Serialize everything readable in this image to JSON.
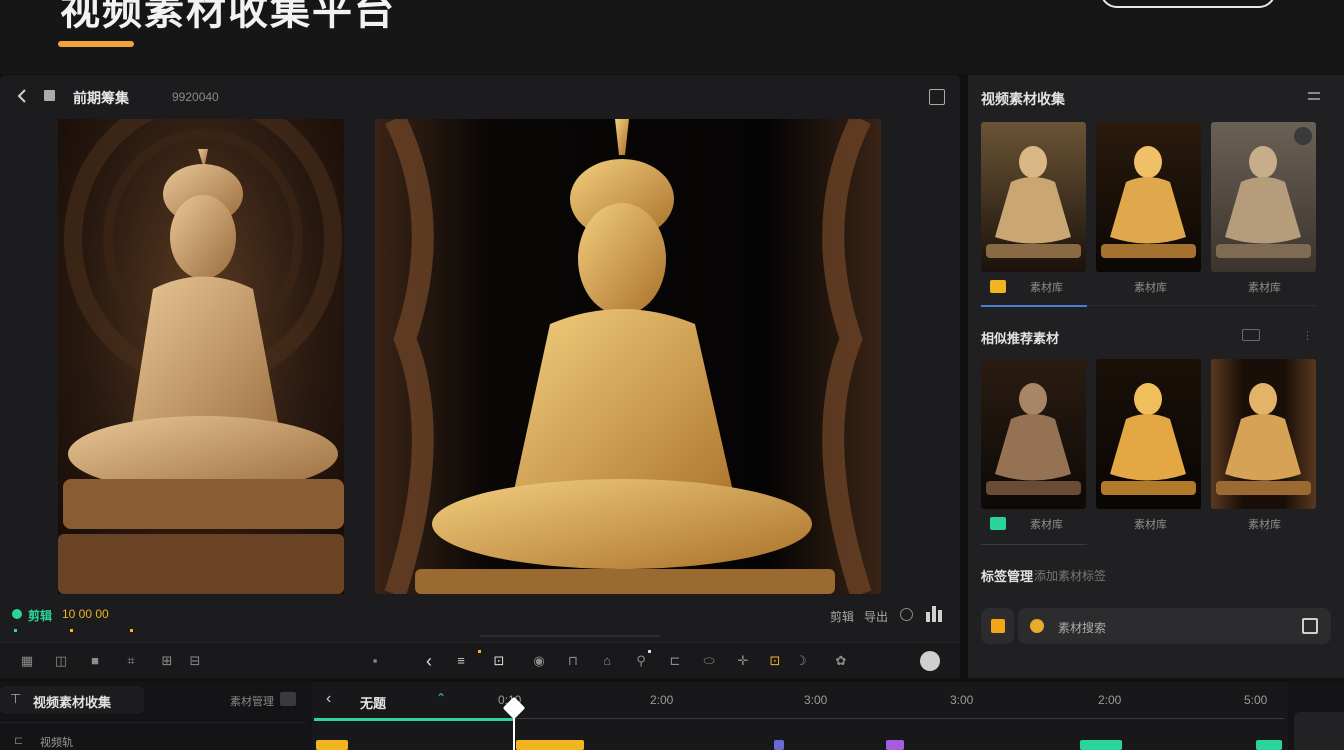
{
  "page": {
    "title": "视频素材收集平台"
  },
  "editor": {
    "header_title": "前期筹集",
    "header_sub": "9920040",
    "status_counter": "10 00 00",
    "status_label": "剪辑",
    "right_labels": [
      "剪辑",
      "导出"
    ]
  },
  "sidebar": {
    "title": "视频素材收集",
    "group1": {
      "labels": [
        "素材库",
        "素材库",
        "素材库"
      ]
    },
    "group2": {
      "title": "相似推荐素材",
      "labels": [
        "素材库",
        "素材库",
        "素材库"
      ]
    },
    "group3": {
      "title": "标签管理",
      "subtitle": "添加素材标签"
    },
    "field": {
      "value": "素材搜索"
    }
  },
  "timeline": {
    "panel_title": "视频素材收集",
    "panel_right": "素材管理",
    "track_label": "视频轨",
    "name": "无题",
    "ticks": [
      "0:10",
      "2:00",
      "3:00",
      "3:00",
      "2:00",
      "5:00"
    ]
  },
  "colors": {
    "accent": "#f0a33a",
    "teal": "#2bd49a",
    "yellow": "#f2b51f",
    "purple": "#a55de0"
  }
}
